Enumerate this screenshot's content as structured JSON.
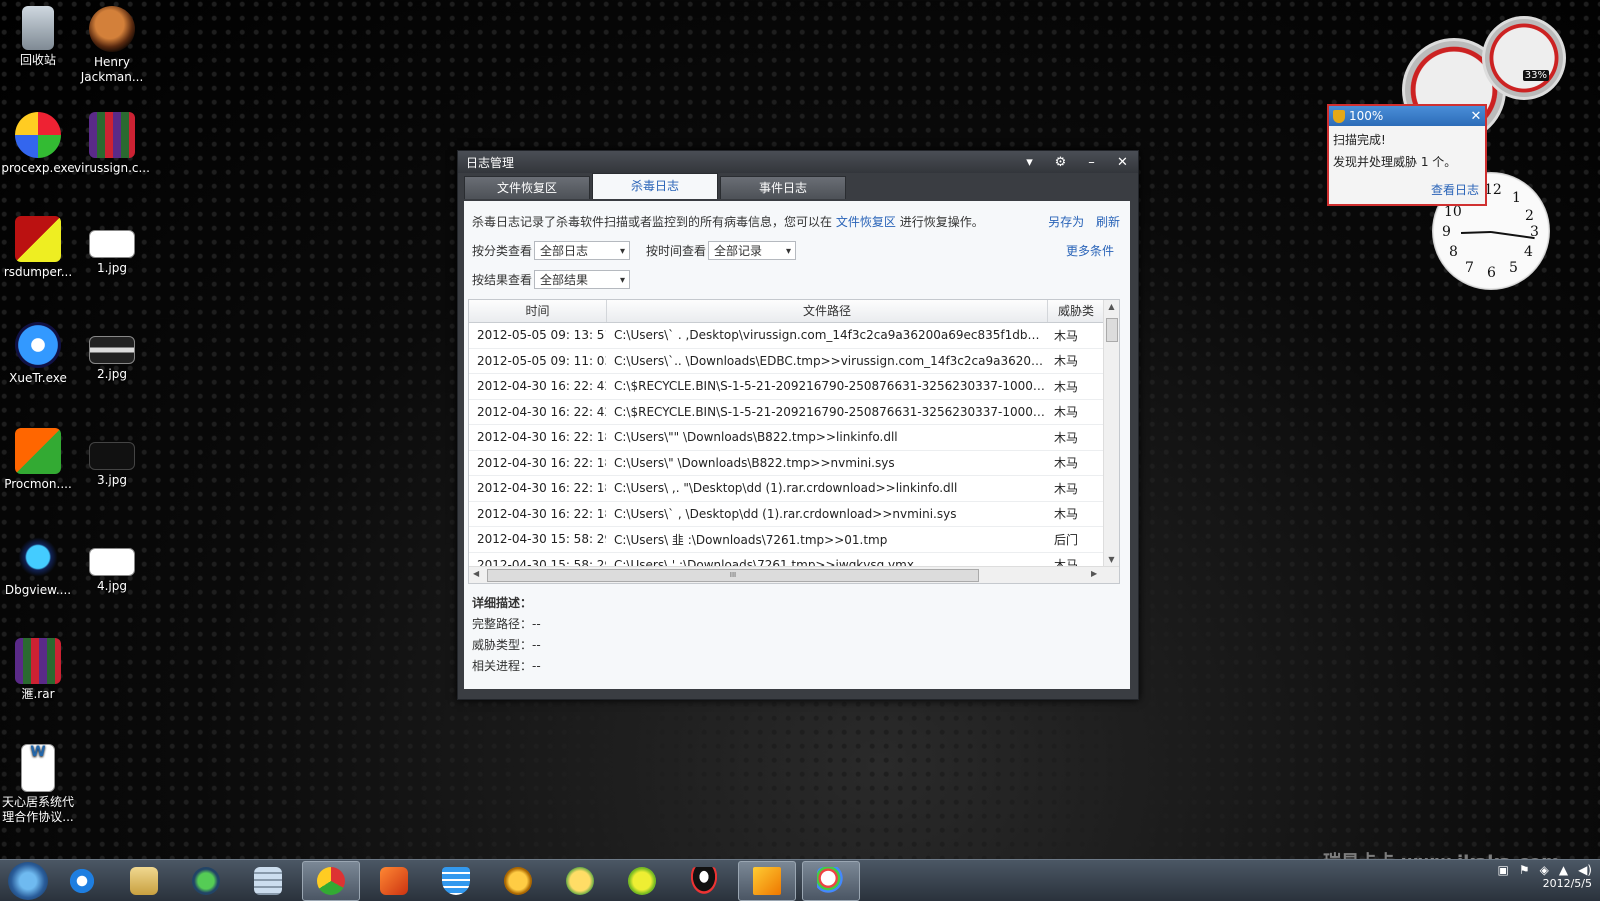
{
  "desktop": {
    "icons": [
      {
        "label": "回收站"
      },
      {
        "label": "Henry Jackman..."
      },
      {
        "label": "procexp.exe"
      },
      {
        "label": "virussign.c..."
      },
      {
        "label": "rsdumper..."
      },
      {
        "label": "1.jpg"
      },
      {
        "label": "XueTr.exe"
      },
      {
        "label": "2.jpg"
      },
      {
        "label": "Procmon...."
      },
      {
        "label": "3.jpg"
      },
      {
        "label": "Dbgview...."
      },
      {
        "label": "4.jpg"
      },
      {
        "label": "滙.rar"
      },
      {
        "label": "天心居系统代理合作协议..."
      }
    ]
  },
  "gadgets": {
    "cpu_percent": "33%",
    "clock_numbers": [
      "12",
      "1",
      "2",
      "3",
      "4",
      "5",
      "6",
      "7",
      "8",
      "9",
      "10",
      "11"
    ]
  },
  "popup": {
    "percent": "100%",
    "line1": "扫描完成!",
    "line2": "发现并处理威胁  1 个。",
    "link": "查看日志",
    "close_icon": "close-icon"
  },
  "window": {
    "title": "日志管理",
    "controls": [
      "▾",
      "⚙",
      "–",
      "✕"
    ],
    "tabs": [
      {
        "label": "文件恢复区",
        "active": false
      },
      {
        "label": "杀毒日志",
        "active": true
      },
      {
        "label": "事件日志",
        "active": false
      }
    ],
    "info_prefix": "杀毒日志记录了杀毒软件扫描或者监控到的所有病毒信息，您可以在",
    "info_link": "文件恢复区",
    "info_suffix": "进行恢复操作。",
    "save_as": "另存为",
    "refresh": "刷新",
    "filter_category_label": "按分类查看",
    "filter_category_value": "全部日志",
    "filter_time_label": "按时间查看",
    "filter_time_value": "全部记录",
    "filter_result_label": "按结果查看",
    "filter_result_value": "全部结果",
    "more_conditions": "更多条件",
    "columns": [
      "时间",
      "文件路径",
      "威胁类"
    ],
    "rows": [
      {
        "time": "2012-05-05 09: 13: 51",
        "path": "C:\\Users\\`  .       ,Desktop\\virussign.com_14f3c2ca9a36200a69ec835f1dbdd...",
        "type": "木马"
      },
      {
        "time": "2012-05-05 09: 11: 03",
        "path": "C:\\Users\\`..        \\Downloads\\EDBC.tmp>>virussign.com_14f3c2ca9a36200a...",
        "type": "木马"
      },
      {
        "time": "2012-04-30 16: 22: 42",
        "path": "C:\\$RECYCLE.BIN\\S-1-5-21-209216790-250876631-3256230337-1000\\$R2E...",
        "type": "木马"
      },
      {
        "time": "2012-04-30 16: 22: 42",
        "path": "C:\\$RECYCLE.BIN\\S-1-5-21-209216790-250876631-3256230337-1000\\$R2E...",
        "type": "木马"
      },
      {
        "time": "2012-04-30 16: 22: 18",
        "path": "C:\\Users\\\"\"      \\Downloads\\B822.tmp>>linkinfo.dll",
        "type": "木马"
      },
      {
        "time": "2012-04-30 16: 22: 18",
        "path": "C:\\Users\\\"         \\Downloads\\B822.tmp>>nvmini.sys",
        "type": "木马"
      },
      {
        "time": "2012-04-30 16: 22: 18",
        "path": "C:\\Users\\  ,.       \"\\Desktop\\dd (1).rar.crdownload>>linkinfo.dll",
        "type": "木马"
      },
      {
        "time": "2012-04-30 16: 22: 18",
        "path": "C:\\Users\\`  ,       \\Desktop\\dd (1).rar.crdownload>>nvmini.sys",
        "type": "木马"
      },
      {
        "time": "2012-04-30 15: 58: 29",
        "path": "C:\\Users\\  韭      :\\Downloads\\7261.tmp>>01.tmp",
        "type": "后门"
      },
      {
        "time": "2012-04-30 15: 58: 29",
        "path": "C:\\Users\\     ' :\\Downloads\\7261.tmp>>jwgkvsq.vmx",
        "type": "木马"
      }
    ],
    "hscroll_grip": "III",
    "detail_title": "详细描述：",
    "detail_path": "完整路径：--",
    "detail_type": "威胁类型：--",
    "detail_process": "相关进程：--"
  },
  "taskbar": {
    "items": [
      "ie-icon",
      "explorer-icon",
      "network-icon",
      "calculator-icon",
      "chrome-icon",
      "media-icon",
      "shield-icon",
      "lion-icon",
      "cat-icon",
      "fruit-icon",
      "qq-icon",
      "notes-icon",
      "paint-icon"
    ],
    "active_items": [
      4,
      11,
      12
    ],
    "date": "2012/5/5"
  },
  "watermark": "瑞星卡卡 www.ikaka.com"
}
